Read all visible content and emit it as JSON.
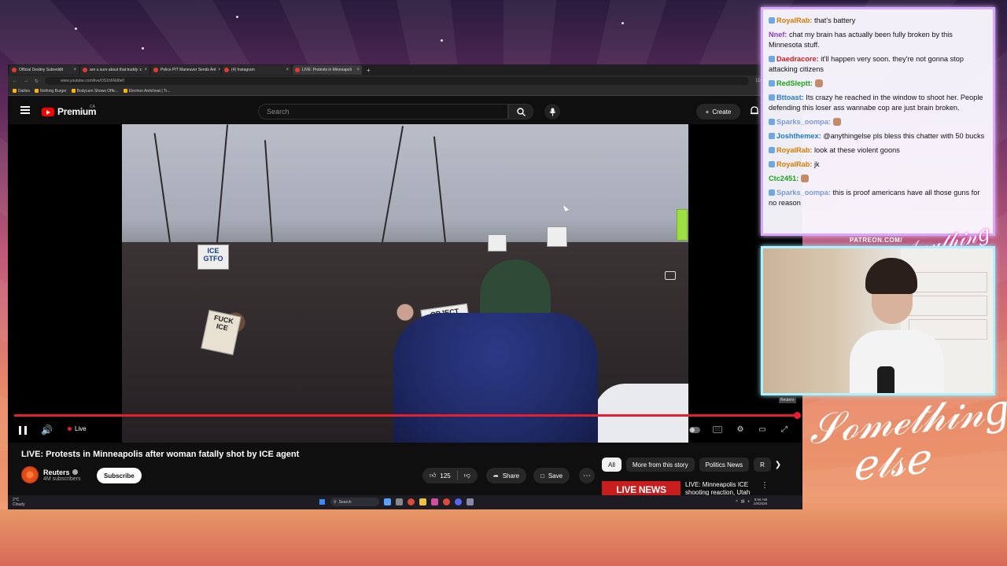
{
  "browser": {
    "tabs": [
      {
        "label": "Official Destiny Subreddit",
        "active": false
      },
      {
        "label": "are u sure about that buddy :c",
        "active": false
      },
      {
        "label": "Police PIT Maneuver Sends Ant",
        "active": false
      },
      {
        "label": "(4) Instagram",
        "active": false
      },
      {
        "label": "LIVE: Protests in Minneapoli",
        "active": true
      }
    ],
    "url": "www.youtube.com/live/OS1h6Nd0e0",
    "zoom": "110%",
    "bookmarks": [
      "Dailies",
      "Nothing Burger",
      "Bodycam Shows Offic...",
      "Electron Anticheat | Tr..."
    ]
  },
  "youtube": {
    "logo_text": "Premium",
    "region": "CA",
    "search_placeholder": "Search",
    "create_label": "Create",
    "video": {
      "title": "LIVE: Protests in Minneapolis after woman fatally shot by ICE agent",
      "live_label": "Live",
      "signs": [
        "ICE GTFO",
        "FUCK ICE",
        "OBJECT"
      ]
    },
    "channel": {
      "name": "Reuters",
      "subscribers": "4M subscribers",
      "subscribe_label": "Subscribe"
    },
    "actions": {
      "likes": "125",
      "share_label": "Share",
      "save_label": "Save"
    },
    "chips": [
      "All",
      "More from this story",
      "Politics News",
      "R"
    ],
    "recommendation": {
      "thumb_text": "LIVE NEWS",
      "title": "LIVE: Minneapolis ICE shooting reaction, Utah mass shooting"
    }
  },
  "taskbar": {
    "weather_temp": "2°C",
    "weather_desc": "Cloudy",
    "search_label": "Search",
    "time": "8:56 AM",
    "date": "1/8/2026"
  },
  "chat": {
    "messages": [
      {
        "user": "RoyalRab",
        "color": "#d47a00",
        "text": "that's battery",
        "badge": true
      },
      {
        "user": "Nnef",
        "color": "#8a3ad6",
        "text": "chat my brain has actually been fully broken by this Minnesota stuff.",
        "badge": false
      },
      {
        "user": "Daedracore",
        "color": "#d02020",
        "text": "it'll happen very soon. they're not gonna stop attacking citizens",
        "badge": true
      },
      {
        "user": "RedSleptt",
        "color": "#1aa31a",
        "text": "",
        "badge": true
      },
      {
        "user": "Bttoast",
        "color": "#2a7ad6",
        "text": "Its crazy he reached in the window to shoot her. People defending this loser ass wannabe cop are just brain broken.",
        "badge": true
      },
      {
        "user": "Sparks_oompa",
        "color": "#7a9ad6",
        "text": "",
        "badge": true
      },
      {
        "user": "Joshthemex",
        "color": "#1a7ad6",
        "text": "@anythingelse pls bless this chatter with 50 bucks",
        "badge": true
      },
      {
        "user": "RoyalRab",
        "color": "#d47a00",
        "text": "look at these violent goons",
        "badge": true
      },
      {
        "user": "RoyalRab",
        "color": "#d47a00",
        "text": "jk",
        "badge": true
      },
      {
        "user": "Ctc2451",
        "color": "#1aa31a",
        "text": "",
        "badge": false
      },
      {
        "user": "Sparks_oompa",
        "color": "#7a9ad6",
        "text": "this is proof americans have all those guns for no reason",
        "badge": true
      }
    ]
  },
  "overlay": {
    "patreon": "PATREON.COM/",
    "signature_top": "Anything else",
    "signature_big": "Something else",
    "video_tag": "Reuters"
  },
  "colors": {
    "accent_red": "#e5202e",
    "chat_border": "#d8a8ff",
    "webcam_border": "#b0f0ff"
  }
}
